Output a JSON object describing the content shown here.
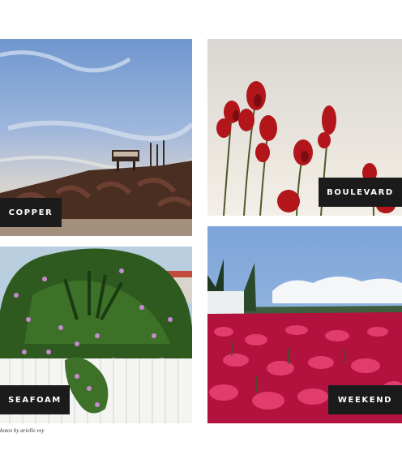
{
  "tiles": [
    {
      "label": "COPPER"
    },
    {
      "label": "BOULEVARD"
    },
    {
      "label": "SEAFOAM"
    },
    {
      "label": "WEEKEND"
    }
  ],
  "credit": "hotos by arielle vey",
  "colors": {
    "label_bg": "#1b1b1b",
    "label_text": "#ffffff",
    "background": "#ffffff"
  }
}
